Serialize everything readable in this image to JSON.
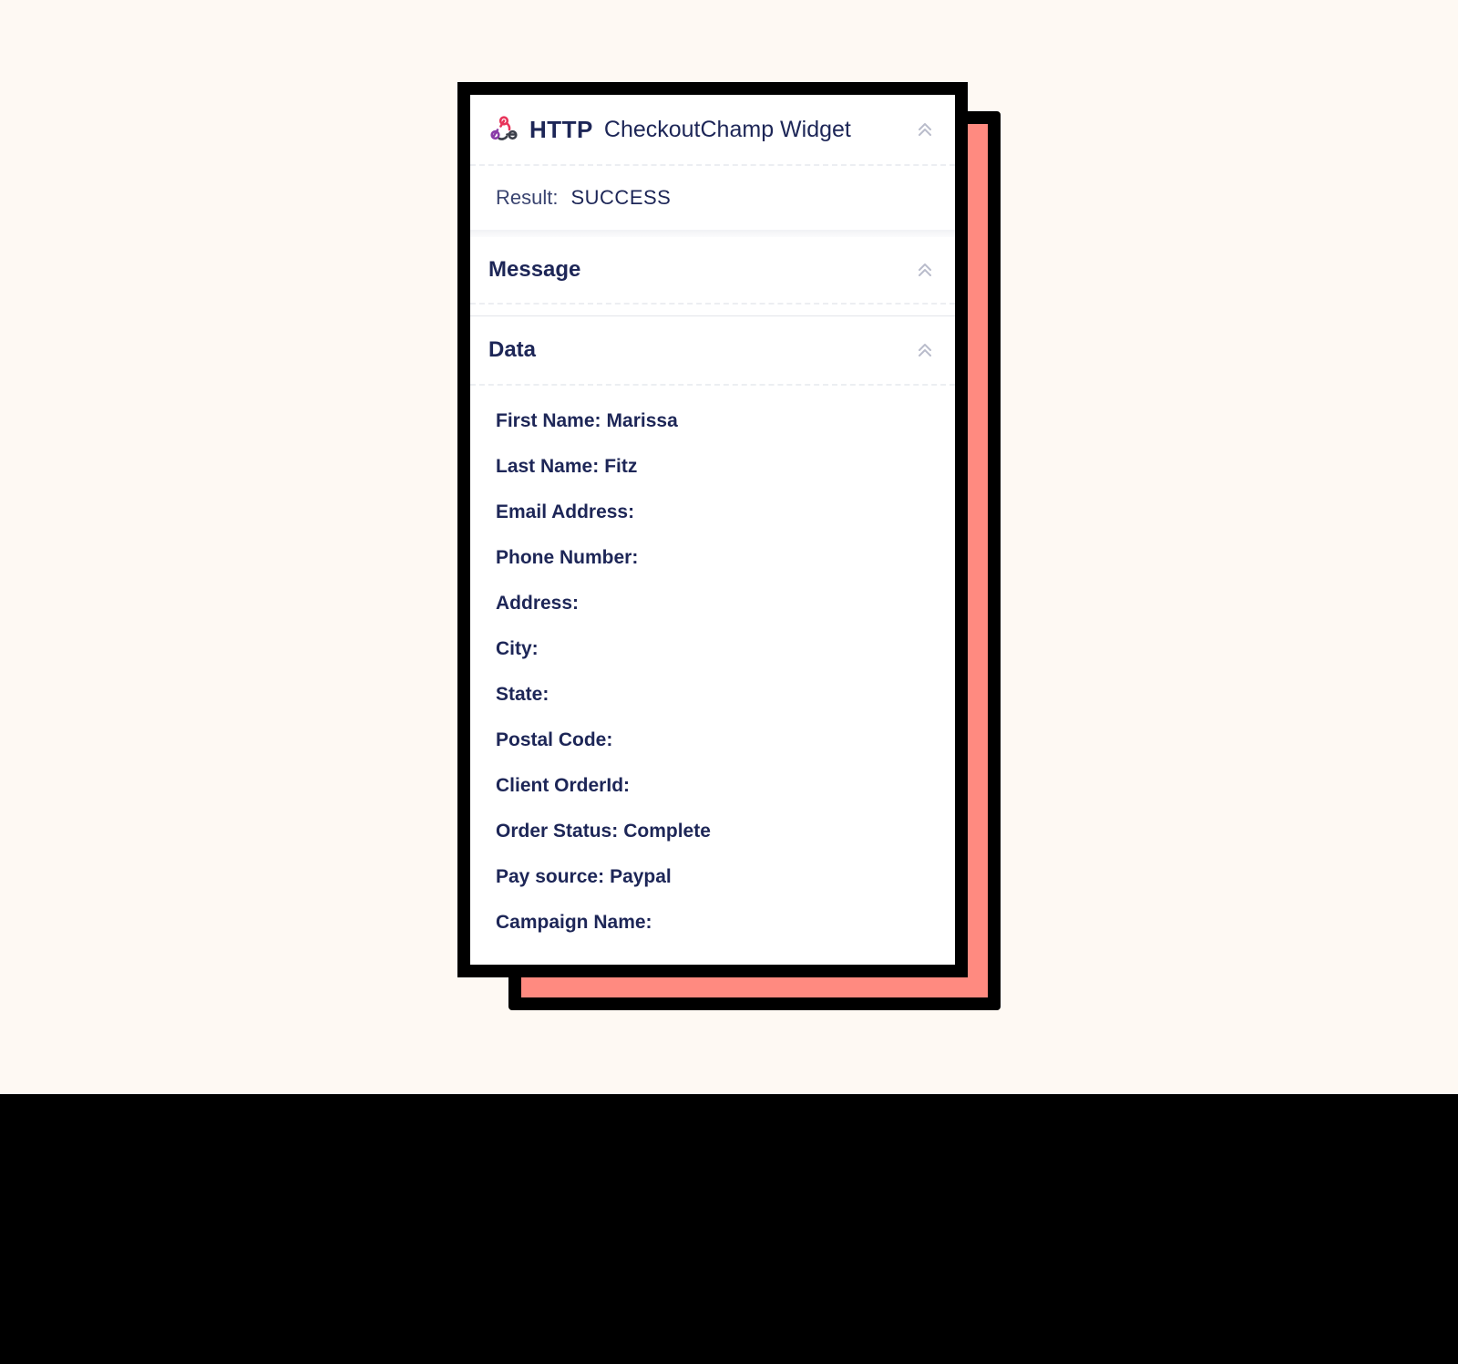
{
  "widget": {
    "protocol": "HTTP",
    "title": "CheckoutChamp Widget",
    "logo_icon": "webhook-icon",
    "collapse_icon": "double-chevron-up-icon"
  },
  "result": {
    "label": "Result:",
    "value": "SUCCESS"
  },
  "sections": {
    "message": {
      "title": "Message"
    },
    "data": {
      "title": "Data"
    }
  },
  "data_fields": [
    {
      "label": "First Name:",
      "value": "Marissa"
    },
    {
      "label": "Last Name:",
      "value": "Fitz"
    },
    {
      "label": "Email Address:",
      "value": ""
    },
    {
      "label": "Phone Number:",
      "value": ""
    },
    {
      "label": "Address:",
      "value": ""
    },
    {
      "label": "City:",
      "value": ""
    },
    {
      "label": "State:",
      "value": ""
    },
    {
      "label": "Postal Code:",
      "value": ""
    },
    {
      "label": "Client OrderId:",
      "value": ""
    },
    {
      "label": "Order Status:",
      "value": "Complete"
    },
    {
      "label": "Pay source:",
      "value": "Paypal"
    },
    {
      "label": "Campaign Name:",
      "value": ""
    }
  ],
  "colors": {
    "background": "#fef9f3",
    "shadow_card": "#ff8a80",
    "text": "#1d2657",
    "border": "#000000"
  }
}
